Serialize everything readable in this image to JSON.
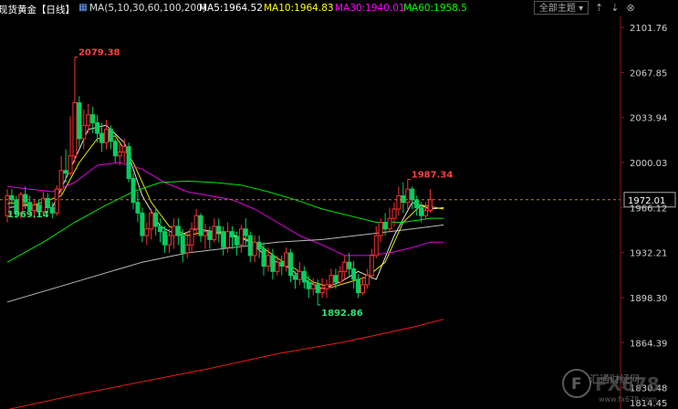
{
  "header": {
    "symbol": "现货黄金【日线】",
    "ma_label": "MA(5,10,30,60,100,200)",
    "ma5": "MA5:1964.52",
    "ma10": "MA10:1964.83",
    "ma30": "MA30:1940.01",
    "ma60": "MA60:1958.5",
    "theme_button": "全部主题",
    "colors": {
      "symbol": "#ffffff",
      "ma5": "#ffffff",
      "ma10": "#ffff00",
      "ma30": "#ff00ff",
      "ma60": "#00ff00"
    }
  },
  "watermark": {
    "brand": "FX678",
    "sub": "汇通财经网",
    "url": "www.fx678.com"
  },
  "chart_data": {
    "type": "candlestick",
    "y_ticks": [
      "2101.76",
      "2067.85",
      "2033.94",
      "2000.03",
      "1966.12",
      "1932.21",
      "1898.30",
      "1864.39",
      "1830.48"
    ],
    "y_bottom_label": "1814.45",
    "ylim": [
      1814.45,
      2110
    ],
    "current_price": "1972.01",
    "annotations": [
      {
        "text": "2079.38",
        "bar": 15,
        "value": 2079.38,
        "kind": "high"
      },
      {
        "text": "1969.14",
        "bar": 0,
        "value": 1969.14,
        "kind": "low"
      },
      {
        "text": "1892.86",
        "bar": 69,
        "value": 1892.86,
        "kind": "low"
      },
      {
        "text": "1987.34",
        "bar": 89,
        "value": 1987.34,
        "kind": "high"
      }
    ],
    "candles": [
      [
        1960,
        1975,
        1955,
        1980
      ],
      [
        1975,
        1972,
        1968,
        1980
      ],
      [
        1972,
        1962,
        1958,
        1975
      ],
      [
        1962,
        1976,
        1958,
        1978
      ],
      [
        1976,
        1970,
        1965,
        1982
      ],
      [
        1970,
        1964,
        1960,
        1975
      ],
      [
        1964,
        1968,
        1958,
        1972
      ],
      [
        1968,
        1963,
        1960,
        1972
      ],
      [
        1963,
        1973,
        1960,
        1978
      ],
      [
        1973,
        1966,
        1962,
        1977
      ],
      [
        1966,
        1962,
        1958,
        1970
      ],
      [
        1962,
        1980,
        1960,
        1983
      ],
      [
        1980,
        1994,
        1975,
        2005
      ],
      [
        1994,
        1992,
        1985,
        2010
      ],
      [
        1992,
        2005,
        1990,
        2035
      ],
      [
        2005,
        2045,
        2000,
        2079.38
      ],
      [
        2045,
        2018,
        2012,
        2050
      ],
      [
        2018,
        2028,
        2010,
        2040
      ],
      [
        2028,
        2036,
        2022,
        2044
      ],
      [
        2036,
        2030,
        2022,
        2042
      ],
      [
        2030,
        2022,
        2015,
        2036
      ],
      [
        2022,
        2015,
        2008,
        2030
      ],
      [
        2015,
        2025,
        2010,
        2032
      ],
      [
        2025,
        2016,
        2010,
        2028
      ],
      [
        2016,
        2005,
        2000,
        2018
      ],
      [
        2005,
        2008,
        1998,
        2014
      ],
      [
        2008,
        2012,
        2000,
        2018
      ],
      [
        2012,
        1988,
        1985,
        2015
      ],
      [
        1988,
        1970,
        1965,
        1992
      ],
      [
        1970,
        1962,
        1955,
        1978
      ],
      [
        1962,
        1945,
        1940,
        1966
      ],
      [
        1945,
        1950,
        1938,
        1955
      ],
      [
        1950,
        1962,
        1942,
        1965
      ],
      [
        1962,
        1952,
        1945,
        1966
      ],
      [
        1952,
        1948,
        1940,
        1958
      ],
      [
        1948,
        1938,
        1932,
        1952
      ],
      [
        1938,
        1945,
        1932,
        1950
      ],
      [
        1945,
        1952,
        1935,
        1958
      ],
      [
        1952,
        1945,
        1938,
        1958
      ],
      [
        1945,
        1932,
        1925,
        1950
      ],
      [
        1932,
        1938,
        1928,
        1948
      ],
      [
        1938,
        1950,
        1932,
        1955
      ],
      [
        1950,
        1960,
        1945,
        1965
      ],
      [
        1960,
        1945,
        1940,
        1962
      ],
      [
        1945,
        1948,
        1935,
        1954
      ],
      [
        1948,
        1942,
        1935,
        1952
      ],
      [
        1942,
        1952,
        1940,
        1958
      ],
      [
        1952,
        1948,
        1940,
        1958
      ],
      [
        1948,
        1936,
        1930,
        1952
      ],
      [
        1936,
        1948,
        1932,
        1955
      ],
      [
        1948,
        1944,
        1935,
        1952
      ],
      [
        1944,
        1938,
        1930,
        1948
      ],
      [
        1938,
        1950,
        1932,
        1953
      ],
      [
        1950,
        1945,
        1938,
        1958
      ],
      [
        1945,
        1930,
        1925,
        1948
      ],
      [
        1930,
        1940,
        1925,
        1945
      ],
      [
        1940,
        1935,
        1928,
        1945
      ],
      [
        1935,
        1922,
        1915,
        1940
      ],
      [
        1922,
        1930,
        1918,
        1936
      ],
      [
        1930,
        1918,
        1912,
        1935
      ],
      [
        1918,
        1925,
        1915,
        1930
      ],
      [
        1925,
        1922,
        1915,
        1930
      ],
      [
        1922,
        1932,
        1918,
        1936
      ],
      [
        1932,
        1915,
        1910,
        1935
      ],
      [
        1915,
        1912,
        1905,
        1918
      ],
      [
        1912,
        1918,
        1908,
        1925
      ],
      [
        1918,
        1910,
        1905,
        1922
      ],
      [
        1910,
        1905,
        1898,
        1915
      ],
      [
        1905,
        1908,
        1900,
        1913
      ],
      [
        1908,
        1902,
        1892.86,
        1912
      ],
      [
        1902,
        1905,
        1898,
        1913
      ],
      [
        1905,
        1908,
        1898,
        1912
      ],
      [
        1908,
        1915,
        1905,
        1920
      ],
      [
        1915,
        1910,
        1905,
        1920
      ],
      [
        1910,
        1918,
        1908,
        1922
      ],
      [
        1918,
        1925,
        1912,
        1930
      ],
      [
        1925,
        1920,
        1915,
        1932
      ],
      [
        1920,
        1912,
        1905,
        1926
      ],
      [
        1912,
        1902,
        1898,
        1916
      ],
      [
        1902,
        1908,
        1900,
        1914
      ],
      [
        1908,
        1915,
        1905,
        1920
      ],
      [
        1915,
        1930,
        1912,
        1935
      ],
      [
        1930,
        1945,
        1928,
        1952
      ],
      [
        1945,
        1955,
        1940,
        1958
      ],
      [
        1955,
        1950,
        1945,
        1962
      ],
      [
        1950,
        1958,
        1948,
        1966
      ],
      [
        1958,
        1965,
        1952,
        1970
      ],
      [
        1965,
        1975,
        1960,
        1982
      ],
      [
        1975,
        1970,
        1962,
        1985
      ],
      [
        1970,
        1980,
        1965,
        1987.34
      ],
      [
        1980,
        1972,
        1965,
        1982
      ],
      [
        1972,
        1966,
        1960,
        1975
      ],
      [
        1966,
        1960,
        1955,
        1970
      ],
      [
        1960,
        1964,
        1958,
        1970
      ],
      [
        1964,
        1972.01,
        1962,
        1980
      ]
    ],
    "ma_series": [
      {
        "name": "MA5",
        "color": "#ffffff",
        "points": [
          [
            0,
            1966
          ],
          [
            5,
            1968
          ],
          [
            10,
            1966
          ],
          [
            14,
            1995
          ],
          [
            18,
            2025
          ],
          [
            22,
            2028
          ],
          [
            26,
            2015
          ],
          [
            30,
            1975
          ],
          [
            34,
            1952
          ],
          [
            38,
            1945
          ],
          [
            42,
            1950
          ],
          [
            46,
            1948
          ],
          [
            50,
            1946
          ],
          [
            54,
            1940
          ],
          [
            58,
            1928
          ],
          [
            62,
            1922
          ],
          [
            66,
            1912
          ],
          [
            70,
            1905
          ],
          [
            74,
            1910
          ],
          [
            78,
            1918
          ],
          [
            82,
            1912
          ],
          [
            86,
            1945
          ],
          [
            90,
            1970
          ],
          [
            94,
            1965
          ],
          [
            97,
            1966
          ]
        ]
      },
      {
        "name": "MA10",
        "color": "#ffff00",
        "points": [
          [
            0,
            1970
          ],
          [
            6,
            1968
          ],
          [
            12,
            1975
          ],
          [
            16,
            2000
          ],
          [
            20,
            2018
          ],
          [
            24,
            2020
          ],
          [
            28,
            2000
          ],
          [
            32,
            1970
          ],
          [
            36,
            1952
          ],
          [
            40,
            1945
          ],
          [
            44,
            1948
          ],
          [
            48,
            1946
          ],
          [
            52,
            1944
          ],
          [
            56,
            1938
          ],
          [
            60,
            1928
          ],
          [
            64,
            1920
          ],
          [
            68,
            1910
          ],
          [
            72,
            1906
          ],
          [
            76,
            1910
          ],
          [
            80,
            1914
          ],
          [
            84,
            1925
          ],
          [
            88,
            1955
          ],
          [
            92,
            1968
          ],
          [
            97,
            1965
          ]
        ]
      },
      {
        "name": "MA30",
        "color": "#ff00ff",
        "points": [
          [
            0,
            1982
          ],
          [
            10,
            1978
          ],
          [
            15,
            1985
          ],
          [
            20,
            1998
          ],
          [
            25,
            2000
          ],
          [
            30,
            1995
          ],
          [
            35,
            1985
          ],
          [
            40,
            1978
          ],
          [
            45,
            1975
          ],
          [
            50,
            1972
          ],
          [
            55,
            1965
          ],
          [
            60,
            1955
          ],
          [
            65,
            1945
          ],
          [
            70,
            1938
          ],
          [
            75,
            1930
          ],
          [
            80,
            1930
          ],
          [
            85,
            1932
          ],
          [
            90,
            1936
          ],
          [
            94,
            1940
          ],
          [
            97,
            1940
          ]
        ]
      },
      {
        "name": "MA60",
        "color": "#00ff00",
        "points": [
          [
            0,
            1925
          ],
          [
            8,
            1940
          ],
          [
            15,
            1955
          ],
          [
            22,
            1968
          ],
          [
            28,
            1978
          ],
          [
            34,
            1985
          ],
          [
            40,
            1986
          ],
          [
            46,
            1985
          ],
          [
            52,
            1983
          ],
          [
            58,
            1978
          ],
          [
            64,
            1972
          ],
          [
            70,
            1965
          ],
          [
            76,
            1960
          ],
          [
            82,
            1955
          ],
          [
            88,
            1955
          ],
          [
            94,
            1958
          ],
          [
            97,
            1958
          ]
        ]
      },
      {
        "name": "MA100",
        "color": "#cfcfcf",
        "points": [
          [
            0,
            1895
          ],
          [
            10,
            1905
          ],
          [
            20,
            1915
          ],
          [
            30,
            1925
          ],
          [
            40,
            1932
          ],
          [
            50,
            1936
          ],
          [
            60,
            1940
          ],
          [
            70,
            1942
          ],
          [
            80,
            1946
          ],
          [
            90,
            1950
          ],
          [
            97,
            1953
          ]
        ]
      },
      {
        "name": "MA200",
        "color": "#ff2020",
        "points": [
          [
            0,
            1814
          ],
          [
            15,
            1825
          ],
          [
            30,
            1835
          ],
          [
            45,
            1845
          ],
          [
            60,
            1856
          ],
          [
            75,
            1865
          ],
          [
            90,
            1876
          ],
          [
            97,
            1882
          ]
        ]
      }
    ]
  }
}
